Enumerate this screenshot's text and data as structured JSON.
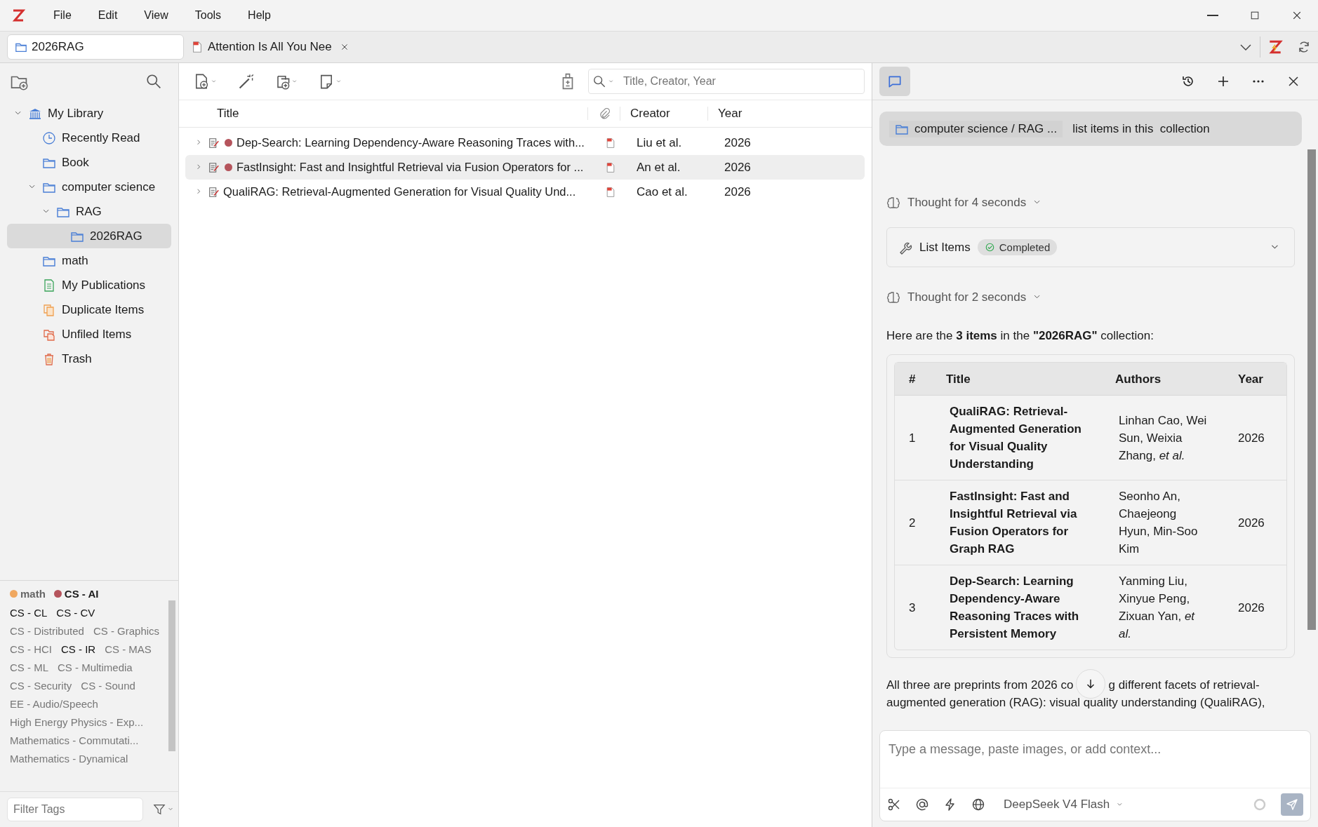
{
  "menu_bar": {
    "items": [
      "File",
      "Edit",
      "View",
      "Tools",
      "Help"
    ]
  },
  "tabs": [
    {
      "label": "2026RAG",
      "kind": "collection",
      "selected": true
    },
    {
      "label": "Attention Is All You Nee",
      "kind": "pdf",
      "selected": false
    }
  ],
  "collections": [
    {
      "label": "My Library",
      "kind": "library",
      "selected": false,
      "expanded": true,
      "children": [
        {
          "label": "Recently Read",
          "kind": "recent",
          "selected": false
        },
        {
          "label": "Book",
          "kind": "folder",
          "selected": false
        },
        {
          "label": "computer science",
          "kind": "folder",
          "selected": false,
          "expanded": true,
          "children": [
            {
              "label": "RAG",
              "kind": "folder",
              "selected": false,
              "expanded": true,
              "children": [
                {
                  "label": "2026RAG",
                  "kind": "folder",
                  "selected": true
                }
              ]
            }
          ]
        },
        {
          "label": "math",
          "kind": "folder",
          "selected": false
        },
        {
          "label": "My Publications",
          "kind": "publications",
          "selected": false
        },
        {
          "label": "Duplicate Items",
          "kind": "duplicates",
          "selected": false
        },
        {
          "label": "Unfiled Items",
          "kind": "unfiled",
          "selected": false
        },
        {
          "label": "Trash",
          "kind": "trash",
          "selected": false
        }
      ]
    }
  ],
  "tags": {
    "colored": [
      {
        "name": "math",
        "color": "#f0a860"
      },
      {
        "name": "CS - AI",
        "color": "#b5545c"
      }
    ],
    "items": [
      {
        "name": "CS - CL",
        "dimmed": false
      },
      {
        "name": "CS - CV",
        "dimmed": false
      },
      {
        "name": "CS - Distributed",
        "dimmed": true
      },
      {
        "name": "CS - Graphics",
        "dimmed": true
      },
      {
        "name": "CS - HCI",
        "dimmed": true
      },
      {
        "name": "CS - IR",
        "dimmed": false
      },
      {
        "name": "CS - MAS",
        "dimmed": true
      },
      {
        "name": "CS - ML",
        "dimmed": true
      },
      {
        "name": "CS - Multimedia",
        "dimmed": true
      },
      {
        "name": "CS - Security",
        "dimmed": true
      },
      {
        "name": "CS - Sound",
        "dimmed": true
      },
      {
        "name": "EE - Audio/Speech",
        "dimmed": true
      },
      {
        "name": "High Energy Physics - Exp...",
        "dimmed": true
      },
      {
        "name": "Mathematics - Commutati...",
        "dimmed": true
      },
      {
        "name": "Mathematics - Dynamical",
        "dimmed": true
      }
    ],
    "filter_placeholder": "Filter Tags"
  },
  "items_table": {
    "search_placeholder": "Title, Creator, Year",
    "columns": [
      "Title",
      "Creator",
      "Year"
    ],
    "rows": [
      {
        "title": "Dep-Search: Learning Dependency-Aware Reasoning Traces with...",
        "creator": "Liu et al.",
        "year": "2026",
        "color": "#b5545c",
        "selected": false
      },
      {
        "title": "FastInsight: Fast and Insightful Retrieval via Fusion Operators for ...",
        "creator": "An et al.",
        "year": "2026",
        "color": "#b5545c",
        "selected": true
      },
      {
        "title": "QualiRAG: Retrieval-Augmented Generation for Visual Quality Und...",
        "creator": "Cao et al.",
        "year": "2026",
        "selected": false
      }
    ]
  },
  "assistant": {
    "context_chip": "computer science / RAG ...",
    "context_prompt": "list items in this  collection",
    "messages": [
      {
        "kind": "thought",
        "text": "Thought for 4 seconds"
      },
      {
        "kind": "tool",
        "name": "List Items",
        "status": "Completed"
      },
      {
        "kind": "thought",
        "text": "Thought for 2 seconds"
      },
      {
        "kind": "text",
        "text": "Here are the **3 items** in the **\"2026RAG\"** collection:"
      },
      {
        "kind": "table",
        "columns": [
          "#",
          "Title",
          "Authors",
          "Year"
        ],
        "rows": [
          [
            "1",
            "QualiRAG: Retrieval-Augmented Generation for Visual Quality Understanding",
            "Linhan Cao, Wei Sun, Weixia Zhang, *et al.*",
            "2026"
          ],
          [
            "2",
            "FastInsight: Fast and Insightful Retrieval via Fusion Operators for Graph RAG",
            "Seonho An, Chaejeong Hyun, Min-Soo Kim",
            "2026"
          ],
          [
            "3",
            "Dep-Search: Learning Dependency-Aware Reasoning Traces with Persistent Memory",
            "Yanming Liu, Xinyue Peng, Zixuan Yan, *et al.*",
            "2026"
          ]
        ]
      },
      {
        "kind": "covered_text",
        "before": "All three are preprints from 2026 co",
        "after": "g different facets of retrieval-",
        "next_line": "augmented generation (RAG): visual quality understanding (QualiRAG),"
      }
    ],
    "input_placeholder": "Type a message, paste images, or add context...",
    "model": "DeepSeek V4 Flash"
  }
}
